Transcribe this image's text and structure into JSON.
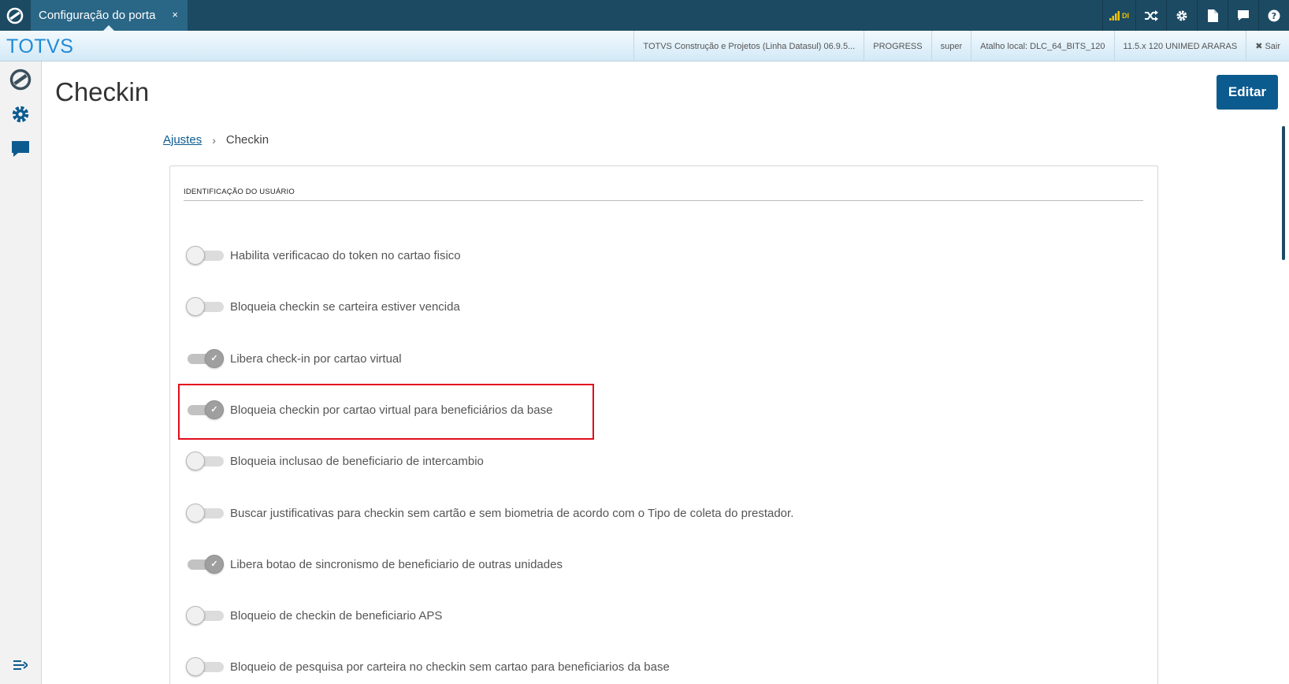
{
  "topbar": {
    "tab_label": "Configuração do porta",
    "tab_close": "×",
    "signal_label": "DI",
    "icons": [
      "totvs-logo-icon",
      "signal-icon",
      "shuffle-icon",
      "gear-icon",
      "document-icon",
      "chat-icon",
      "help-icon"
    ]
  },
  "status": {
    "brand": "TOTVS",
    "items": [
      "TOTVS Construção e Projetos (Linha Datasul) 06.9.5...",
      "PROGRESS",
      "super",
      "Atalho local: DLC_64_BITS_120",
      "11.5.x 120 UNIMED ARARAS"
    ],
    "exit_icon": "✖",
    "exit_label": "Sair"
  },
  "sidebar": {
    "icons": [
      "totvs-logo-icon",
      "gear-icon",
      "chat-icon",
      "expand-menu-icon"
    ]
  },
  "page": {
    "title": "Checkin",
    "edit_label": "Editar"
  },
  "breadcrumb": {
    "parent": "Ajustes",
    "separator": "›",
    "current": "Checkin"
  },
  "section": {
    "title": "IDENTIFICAÇÃO DO USUÁRIO"
  },
  "toggles": [
    {
      "label": "Habilita verificacao do token no cartao fisico",
      "on": false
    },
    {
      "label": "Bloqueia checkin se carteira estiver vencida",
      "on": false
    },
    {
      "label": "Libera check-in por cartao virtual",
      "on": true
    },
    {
      "label": "Bloqueia checkin por cartao virtual para beneficiários da base",
      "on": true
    },
    {
      "label": "Bloqueia inclusao de beneficiario de intercambio",
      "on": false
    },
    {
      "label": "Buscar justificativas para checkin sem cartão e sem biometria de acordo com o Tipo de coleta do prestador.",
      "on": false
    },
    {
      "label": "Libera botao de sincronismo de beneficiario de outras unidades",
      "on": true
    },
    {
      "label": "Bloqueio de checkin de beneficiario APS",
      "on": false
    },
    {
      "label": "Bloqueio de pesquisa por carteira no checkin sem cartao para beneficiarios da base",
      "on": false
    }
  ],
  "colors": {
    "topbar": "#1c4a63",
    "tab": "#2a6686",
    "brand": "#1e8bd6",
    "primary": "#0c5b8f",
    "highlight": "#e10b1b"
  }
}
